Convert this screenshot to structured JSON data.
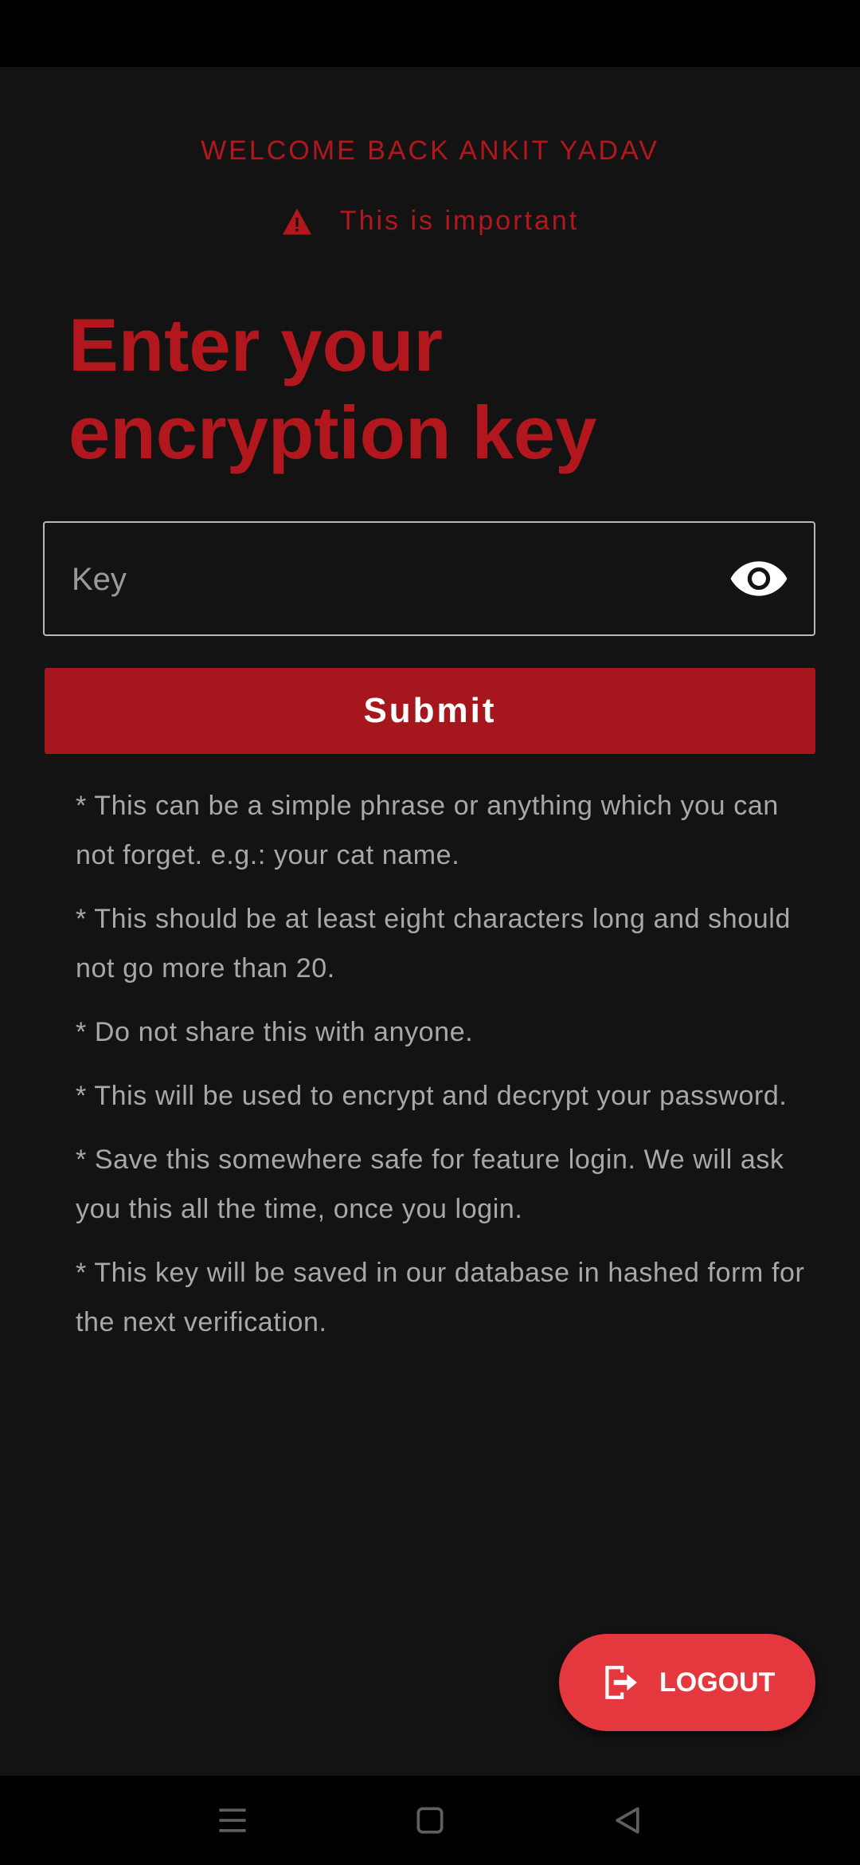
{
  "header": {
    "welcome_text": "WELCOME BACK ANKIT YADAV",
    "important_text": "This is important"
  },
  "heading": {
    "line1": "Enter your",
    "line2": "encryption key"
  },
  "key_field": {
    "placeholder": "Key",
    "value": ""
  },
  "submit_label": "Submit",
  "notes": [
    "* This can be a simple phrase or anything which you can not forget. e.g.: your cat name.",
    "* This should be at least eight characters long and should not go more than 20.",
    "* Do not share this with anyone.",
    "* This will be used to encrypt and decrypt your password.",
    "* Save this somewhere safe for feature login. We will ask you this all the time, once you login.",
    "* This key will be saved in our database in hashed form for the next verification."
  ],
  "logout_label": "LOGOUT",
  "icons": {
    "warning": "warning-triangle-icon",
    "visibility": "eye-icon",
    "logout": "logout-icon",
    "nav_menu": "menu-icon",
    "nav_home": "home-square-icon",
    "nav_back": "back-triangle-icon"
  },
  "colors": {
    "background": "#131313",
    "accent_red": "#b3171e",
    "submit_red": "#a5171d",
    "logout_red": "#e4383e",
    "note_text": "#a8a8a8"
  }
}
